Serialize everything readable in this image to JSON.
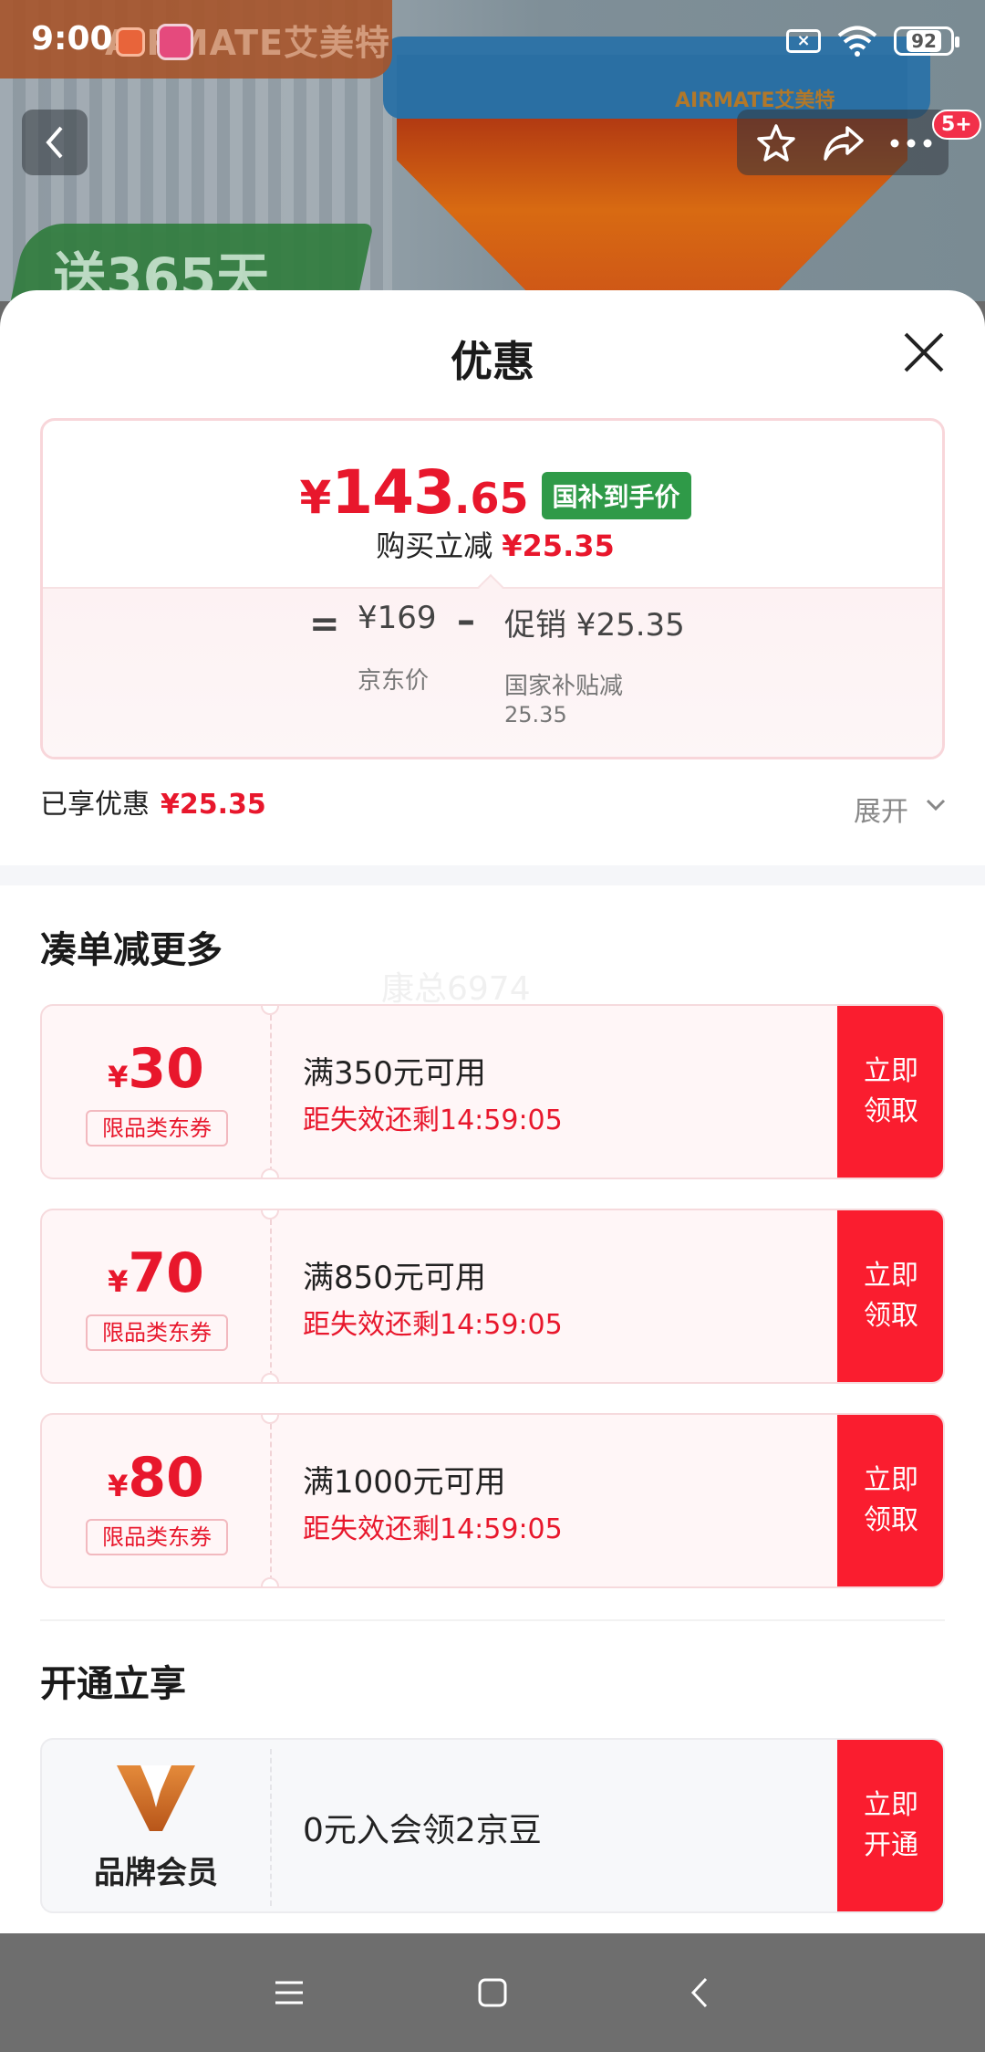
{
  "status_bar": {
    "time": "9:00",
    "battery": "92"
  },
  "background": {
    "brand_text": "AIRMATE艾美特",
    "brand_text_right": "AIRMATE艾美特",
    "promo_text": "送365天"
  },
  "header": {
    "notification_badge": "5+"
  },
  "sheet": {
    "title": "优惠",
    "price": {
      "symbol": "¥",
      "integer": "143",
      "decimal": ".65",
      "tag": "国补到手价",
      "reduce_label": "购买立减",
      "reduce_amount": "¥25.35",
      "calc": {
        "eq": "=",
        "jd_price": "¥169",
        "jd_label": "京东价",
        "minus": "–",
        "promo": "促销 ¥25.35",
        "promo_label": "国家补贴减",
        "promo_amount": "25.35"
      }
    },
    "enjoyed_label": "已享优惠",
    "enjoyed_amount": "¥25.35",
    "expand_label": "展开",
    "section_more": "凑单减更多",
    "watermark": "康总6974",
    "coupons": [
      {
        "symbol": "¥",
        "value": "30",
        "tag": "限品类东券",
        "condition": "满350元可用",
        "expires": "距失效还剩14:59:05",
        "button": [
          "立即",
          "领取"
        ]
      },
      {
        "symbol": "¥",
        "value": "70",
        "tag": "限品类东券",
        "condition": "满850元可用",
        "expires": "距失效还剩14:59:05",
        "button": [
          "立即",
          "领取"
        ]
      },
      {
        "symbol": "¥",
        "value": "80",
        "tag": "限品类东券",
        "condition": "满1000元可用",
        "expires": "距失效还剩14:59:05",
        "button": [
          "立即",
          "领取"
        ]
      }
    ],
    "section_open": "开通立享",
    "member": {
      "name": "品牌会员",
      "text": "0元入会领2京豆",
      "button": [
        "立即",
        "开通"
      ]
    }
  },
  "colors": {
    "accent": "#fa1d2f",
    "price_red": "#e8172c",
    "tag_green": "#2f9a48"
  }
}
